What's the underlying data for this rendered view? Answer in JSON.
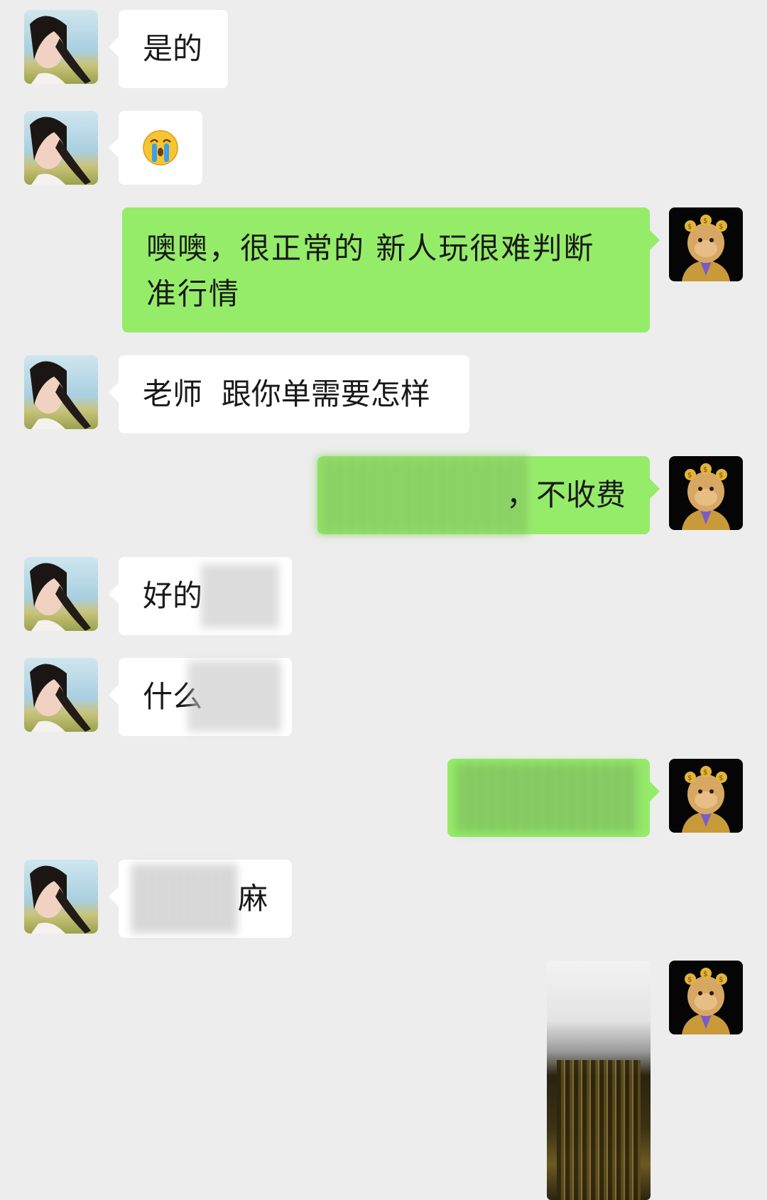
{
  "messages": [
    {
      "side": "left",
      "text": "是的"
    },
    {
      "side": "left",
      "emoji": "crying-face"
    },
    {
      "side": "right",
      "text": "噢噢，很正常的 新人玩很难判断准行情"
    },
    {
      "side": "left",
      "text": "老师  跟你单需要怎样"
    },
    {
      "side": "right",
      "text": "，不收费",
      "redacted": true
    },
    {
      "side": "left",
      "text": "好的",
      "redacted": true
    },
    {
      "side": "left",
      "text": "什么",
      "redacted": true
    },
    {
      "side": "right",
      "text": "",
      "redacted": true
    },
    {
      "side": "left",
      "text": "麻",
      "redacted": true
    },
    {
      "side": "right",
      "media": "video-thumbnail",
      "redacted": true
    }
  ],
  "colors": {
    "background": "#ededed",
    "incoming_bubble": "#ffffff",
    "outgoing_bubble": "#95ec69",
    "text": "#191919"
  }
}
